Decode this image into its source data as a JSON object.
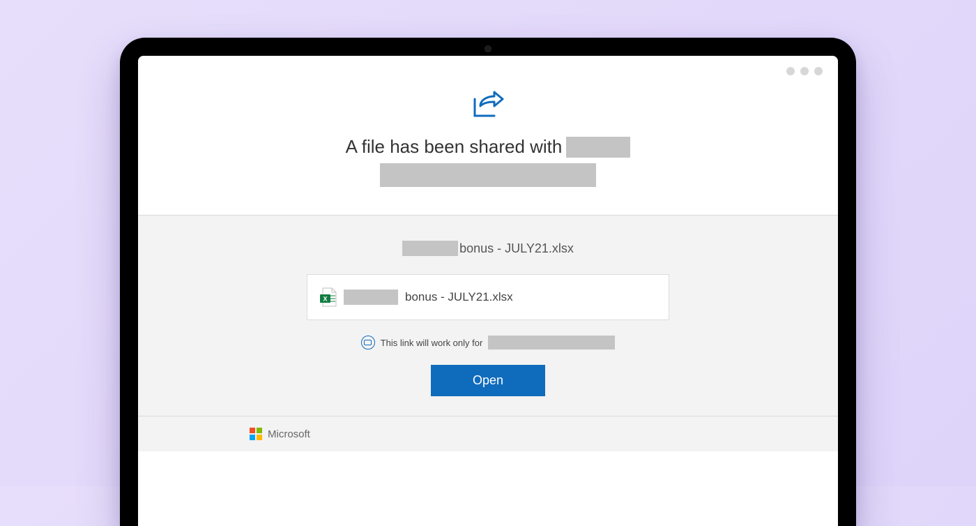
{
  "header": {
    "headline_text": "A file has been shared with"
  },
  "body": {
    "filename_visible_suffix": "bonus - JULY21.xlsx",
    "filebox_filename_suffix": "bonus - JULY21.xlsx",
    "link_note_text": "This link will work only for",
    "open_button_label": "Open"
  },
  "footer": {
    "brand": "Microsoft"
  },
  "colors": {
    "accent": "#0f6cbd"
  }
}
